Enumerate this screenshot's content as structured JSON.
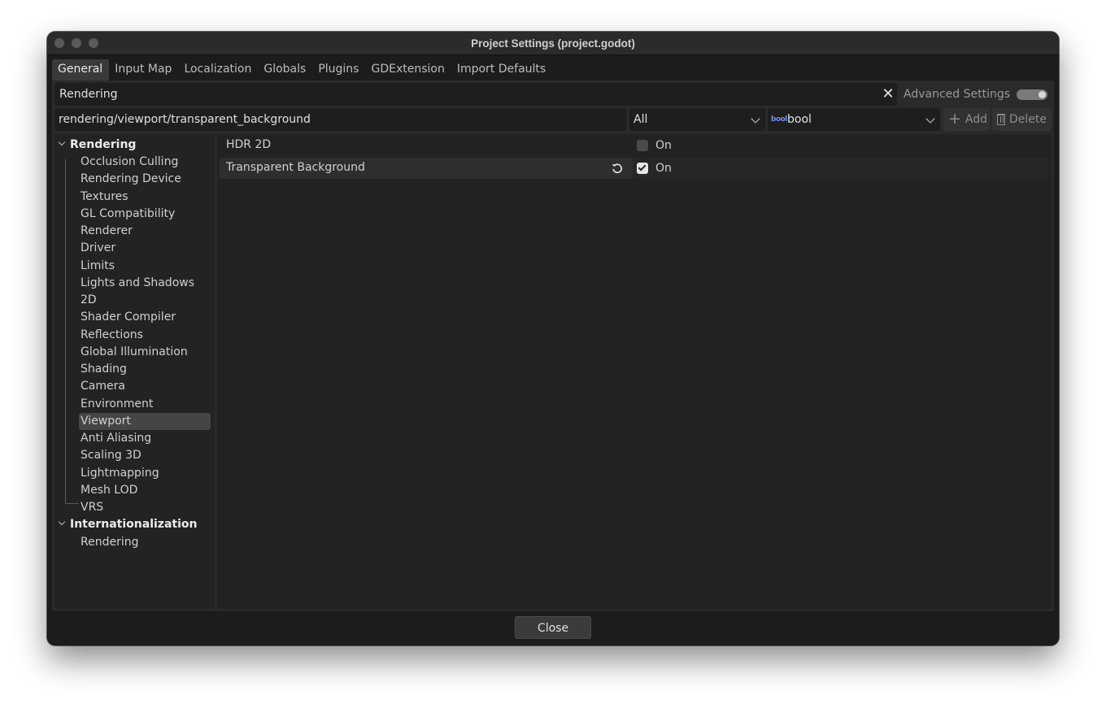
{
  "window": {
    "title": "Project Settings (project.godot)"
  },
  "tabs": [
    {
      "label": "General",
      "active": true
    },
    {
      "label": "Input Map"
    },
    {
      "label": "Localization"
    },
    {
      "label": "Globals"
    },
    {
      "label": "Plugins"
    },
    {
      "label": "GDExtension"
    },
    {
      "label": "Import Defaults"
    }
  ],
  "search": {
    "value": "Rendering",
    "advanced_label": "Advanced Settings",
    "advanced_on": true
  },
  "path_bar": {
    "path": "rendering/viewport/transparent_background",
    "filter": "All",
    "type_icon": "bool",
    "type": "bool",
    "add_label": "Add",
    "delete_label": "Delete"
  },
  "tree": {
    "sections": [
      {
        "label": "Rendering",
        "children": [
          "Occlusion Culling",
          "Rendering Device",
          "Textures",
          "GL Compatibility",
          "Renderer",
          "Driver",
          "Limits",
          "Lights and Shadows",
          "2D",
          "Shader Compiler",
          "Reflections",
          "Global Illumination",
          "Shading",
          "Camera",
          "Environment",
          "Viewport",
          "Anti Aliasing",
          "Scaling 3D",
          "Lightmapping",
          "Mesh LOD",
          "VRS"
        ],
        "selected": "Viewport"
      },
      {
        "label": "Internationalization",
        "children": [
          "Rendering"
        ]
      }
    ]
  },
  "properties": [
    {
      "name": "HDR 2D",
      "checked": false,
      "value_label": "On"
    },
    {
      "name": "Transparent Background",
      "checked": true,
      "value_label": "On",
      "revertable": true
    }
  ],
  "footer": {
    "close_label": "Close"
  },
  "colors": {
    "accent_bool": "#6c8dee",
    "window_bg": "#1c1c1c",
    "panel_bg": "#2a2a2a"
  }
}
